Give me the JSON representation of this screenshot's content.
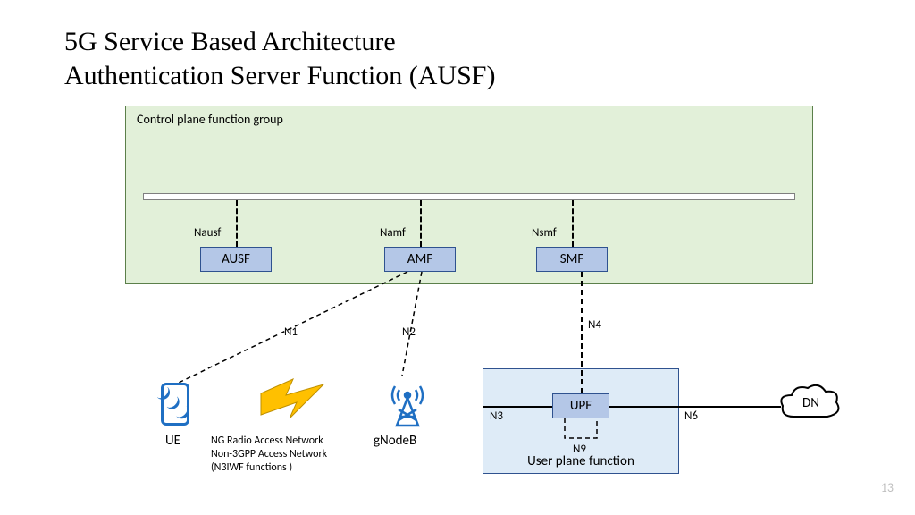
{
  "title_line1": "5G Service Based Architecture",
  "title_line2": "Authentication Server Function (AUSF)",
  "control_plane_label": "Control plane function group",
  "user_plane_label": "User plane function",
  "interfaces": {
    "nausf": "Nausf",
    "namf": "Namf",
    "nsmf": "Nsmf",
    "n1": "N1",
    "n2": "N2",
    "n3": "N3",
    "n4": "N4",
    "n6": "N6",
    "n9": "N9"
  },
  "nodes": {
    "ausf": "AUSF",
    "amf": "AMF",
    "smf": "SMF",
    "upf": "UPF",
    "ue": "UE",
    "gnb": "gNodeB",
    "dn": "DN"
  },
  "ran_text_line1": "NG Radio Access Network",
  "ran_text_line2": "Non-3GPP Access Network",
  "ran_text_line3": "(N3IWF functions )",
  "page_number": "13"
}
